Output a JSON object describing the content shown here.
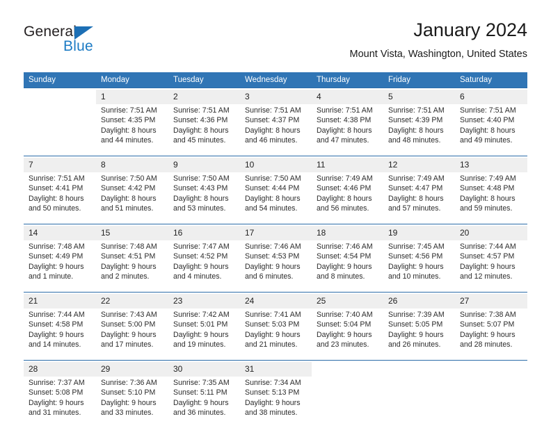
{
  "branding": {
    "logo_general": "General",
    "logo_blue": "Blue",
    "accent_color": "#3075b5",
    "logo_blue_color": "#1c7bc4",
    "separator_color": "#2a6ba8",
    "daynum_band_color": "#efefef"
  },
  "header": {
    "title": "January 2024",
    "subtitle": "Mount Vista, Washington, United States"
  },
  "weekdays": [
    "Sunday",
    "Monday",
    "Tuesday",
    "Wednesday",
    "Thursday",
    "Friday",
    "Saturday"
  ],
  "weeks": [
    [
      {
        "day": "",
        "sunrise": "",
        "sunset": "",
        "daylight1": "",
        "daylight2": ""
      },
      {
        "day": "1",
        "sunrise": "Sunrise: 7:51 AM",
        "sunset": "Sunset: 4:35 PM",
        "daylight1": "Daylight: 8 hours",
        "daylight2": "and 44 minutes."
      },
      {
        "day": "2",
        "sunrise": "Sunrise: 7:51 AM",
        "sunset": "Sunset: 4:36 PM",
        "daylight1": "Daylight: 8 hours",
        "daylight2": "and 45 minutes."
      },
      {
        "day": "3",
        "sunrise": "Sunrise: 7:51 AM",
        "sunset": "Sunset: 4:37 PM",
        "daylight1": "Daylight: 8 hours",
        "daylight2": "and 46 minutes."
      },
      {
        "day": "4",
        "sunrise": "Sunrise: 7:51 AM",
        "sunset": "Sunset: 4:38 PM",
        "daylight1": "Daylight: 8 hours",
        "daylight2": "and 47 minutes."
      },
      {
        "day": "5",
        "sunrise": "Sunrise: 7:51 AM",
        "sunset": "Sunset: 4:39 PM",
        "daylight1": "Daylight: 8 hours",
        "daylight2": "and 48 minutes."
      },
      {
        "day": "6",
        "sunrise": "Sunrise: 7:51 AM",
        "sunset": "Sunset: 4:40 PM",
        "daylight1": "Daylight: 8 hours",
        "daylight2": "and 49 minutes."
      }
    ],
    [
      {
        "day": "7",
        "sunrise": "Sunrise: 7:51 AM",
        "sunset": "Sunset: 4:41 PM",
        "daylight1": "Daylight: 8 hours",
        "daylight2": "and 50 minutes."
      },
      {
        "day": "8",
        "sunrise": "Sunrise: 7:50 AM",
        "sunset": "Sunset: 4:42 PM",
        "daylight1": "Daylight: 8 hours",
        "daylight2": "and 51 minutes."
      },
      {
        "day": "9",
        "sunrise": "Sunrise: 7:50 AM",
        "sunset": "Sunset: 4:43 PM",
        "daylight1": "Daylight: 8 hours",
        "daylight2": "and 53 minutes."
      },
      {
        "day": "10",
        "sunrise": "Sunrise: 7:50 AM",
        "sunset": "Sunset: 4:44 PM",
        "daylight1": "Daylight: 8 hours",
        "daylight2": "and 54 minutes."
      },
      {
        "day": "11",
        "sunrise": "Sunrise: 7:49 AM",
        "sunset": "Sunset: 4:46 PM",
        "daylight1": "Daylight: 8 hours",
        "daylight2": "and 56 minutes."
      },
      {
        "day": "12",
        "sunrise": "Sunrise: 7:49 AM",
        "sunset": "Sunset: 4:47 PM",
        "daylight1": "Daylight: 8 hours",
        "daylight2": "and 57 minutes."
      },
      {
        "day": "13",
        "sunrise": "Sunrise: 7:49 AM",
        "sunset": "Sunset: 4:48 PM",
        "daylight1": "Daylight: 8 hours",
        "daylight2": "and 59 minutes."
      }
    ],
    [
      {
        "day": "14",
        "sunrise": "Sunrise: 7:48 AM",
        "sunset": "Sunset: 4:49 PM",
        "daylight1": "Daylight: 9 hours",
        "daylight2": "and 1 minute."
      },
      {
        "day": "15",
        "sunrise": "Sunrise: 7:48 AM",
        "sunset": "Sunset: 4:51 PM",
        "daylight1": "Daylight: 9 hours",
        "daylight2": "and 2 minutes."
      },
      {
        "day": "16",
        "sunrise": "Sunrise: 7:47 AM",
        "sunset": "Sunset: 4:52 PM",
        "daylight1": "Daylight: 9 hours",
        "daylight2": "and 4 minutes."
      },
      {
        "day": "17",
        "sunrise": "Sunrise: 7:46 AM",
        "sunset": "Sunset: 4:53 PM",
        "daylight1": "Daylight: 9 hours",
        "daylight2": "and 6 minutes."
      },
      {
        "day": "18",
        "sunrise": "Sunrise: 7:46 AM",
        "sunset": "Sunset: 4:54 PM",
        "daylight1": "Daylight: 9 hours",
        "daylight2": "and 8 minutes."
      },
      {
        "day": "19",
        "sunrise": "Sunrise: 7:45 AM",
        "sunset": "Sunset: 4:56 PM",
        "daylight1": "Daylight: 9 hours",
        "daylight2": "and 10 minutes."
      },
      {
        "day": "20",
        "sunrise": "Sunrise: 7:44 AM",
        "sunset": "Sunset: 4:57 PM",
        "daylight1": "Daylight: 9 hours",
        "daylight2": "and 12 minutes."
      }
    ],
    [
      {
        "day": "21",
        "sunrise": "Sunrise: 7:44 AM",
        "sunset": "Sunset: 4:58 PM",
        "daylight1": "Daylight: 9 hours",
        "daylight2": "and 14 minutes."
      },
      {
        "day": "22",
        "sunrise": "Sunrise: 7:43 AM",
        "sunset": "Sunset: 5:00 PM",
        "daylight1": "Daylight: 9 hours",
        "daylight2": "and 17 minutes."
      },
      {
        "day": "23",
        "sunrise": "Sunrise: 7:42 AM",
        "sunset": "Sunset: 5:01 PM",
        "daylight1": "Daylight: 9 hours",
        "daylight2": "and 19 minutes."
      },
      {
        "day": "24",
        "sunrise": "Sunrise: 7:41 AM",
        "sunset": "Sunset: 5:03 PM",
        "daylight1": "Daylight: 9 hours",
        "daylight2": "and 21 minutes."
      },
      {
        "day": "25",
        "sunrise": "Sunrise: 7:40 AM",
        "sunset": "Sunset: 5:04 PM",
        "daylight1": "Daylight: 9 hours",
        "daylight2": "and 23 minutes."
      },
      {
        "day": "26",
        "sunrise": "Sunrise: 7:39 AM",
        "sunset": "Sunset: 5:05 PM",
        "daylight1": "Daylight: 9 hours",
        "daylight2": "and 26 minutes."
      },
      {
        "day": "27",
        "sunrise": "Sunrise: 7:38 AM",
        "sunset": "Sunset: 5:07 PM",
        "daylight1": "Daylight: 9 hours",
        "daylight2": "and 28 minutes."
      }
    ],
    [
      {
        "day": "28",
        "sunrise": "Sunrise: 7:37 AM",
        "sunset": "Sunset: 5:08 PM",
        "daylight1": "Daylight: 9 hours",
        "daylight2": "and 31 minutes."
      },
      {
        "day": "29",
        "sunrise": "Sunrise: 7:36 AM",
        "sunset": "Sunset: 5:10 PM",
        "daylight1": "Daylight: 9 hours",
        "daylight2": "and 33 minutes."
      },
      {
        "day": "30",
        "sunrise": "Sunrise: 7:35 AM",
        "sunset": "Sunset: 5:11 PM",
        "daylight1": "Daylight: 9 hours",
        "daylight2": "and 36 minutes."
      },
      {
        "day": "31",
        "sunrise": "Sunrise: 7:34 AM",
        "sunset": "Sunset: 5:13 PM",
        "daylight1": "Daylight: 9 hours",
        "daylight2": "and 38 minutes."
      },
      {
        "day": "",
        "sunrise": "",
        "sunset": "",
        "daylight1": "",
        "daylight2": ""
      },
      {
        "day": "",
        "sunrise": "",
        "sunset": "",
        "daylight1": "",
        "daylight2": ""
      },
      {
        "day": "",
        "sunrise": "",
        "sunset": "",
        "daylight1": "",
        "daylight2": ""
      }
    ]
  ]
}
